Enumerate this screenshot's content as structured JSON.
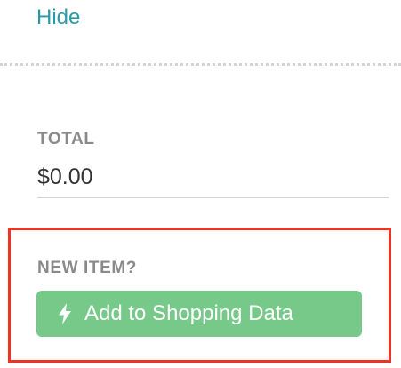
{
  "top": {
    "hide_link": "Hide"
  },
  "total": {
    "label": "TOTAL",
    "value": "$0.00"
  },
  "new_item": {
    "label": "NEW ITEM?",
    "button_label": "Add to Shopping Data",
    "button_icon": "lightning-bolt-icon"
  },
  "colors": {
    "link": "#2a9aa8",
    "button_bg": "#77c98a",
    "highlight_border": "#ee3322",
    "label_gray": "#8a8a8a"
  }
}
